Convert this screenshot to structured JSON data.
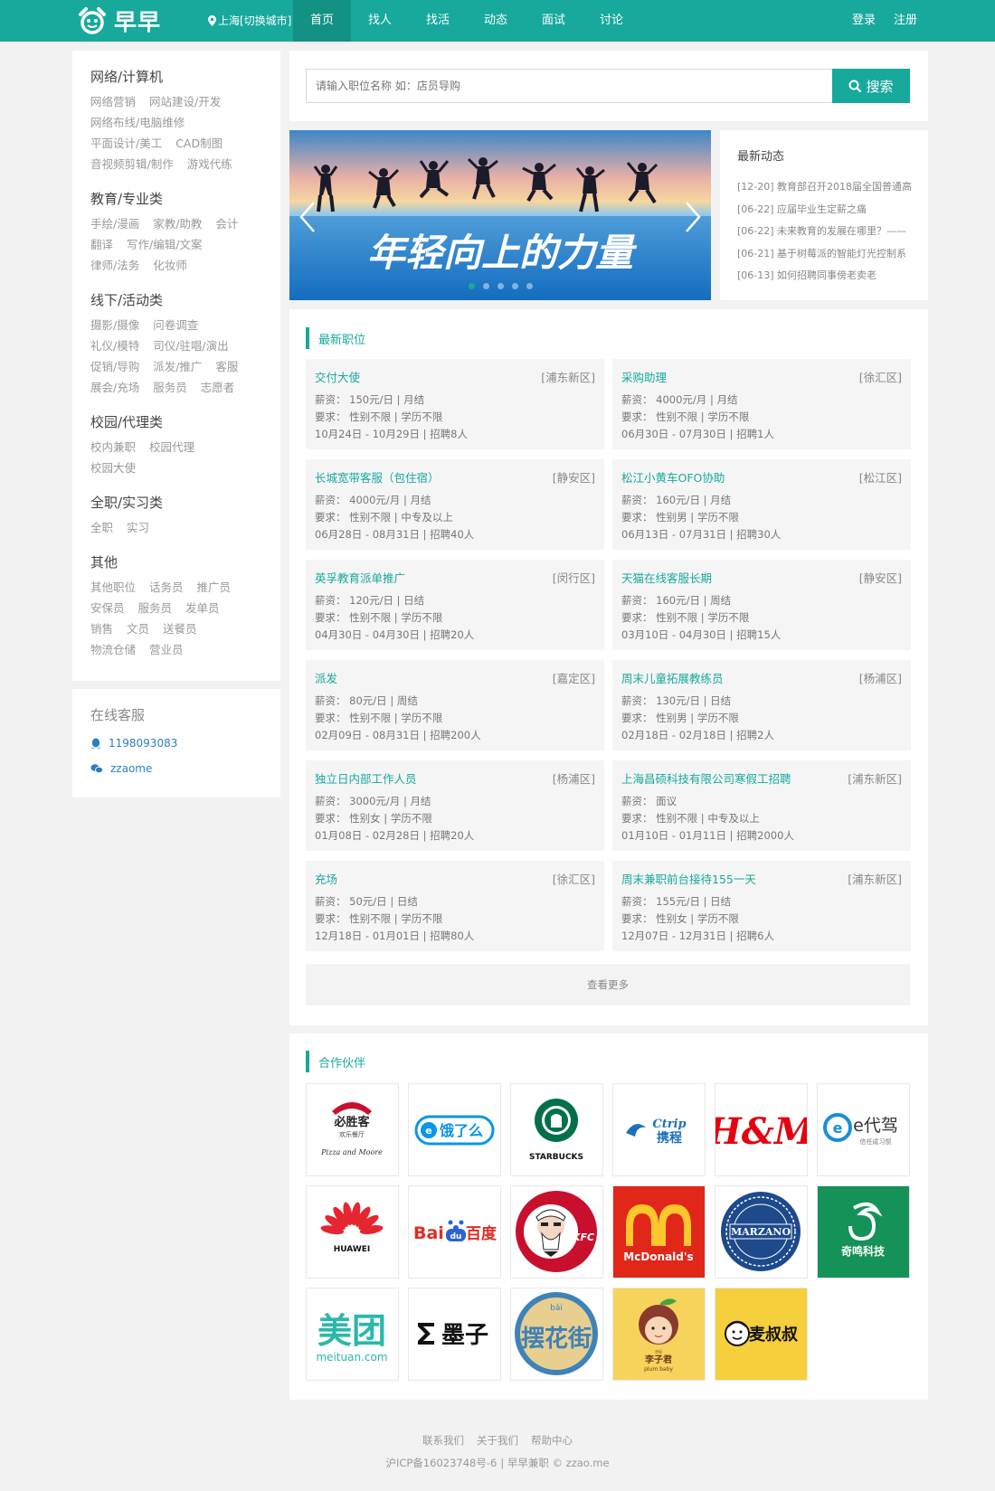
{
  "header": {
    "logo_text": "早早",
    "city": "上海[切换城市]",
    "nav": [
      {
        "label": "首页",
        "active": true
      },
      {
        "label": "找人"
      },
      {
        "label": "找活"
      },
      {
        "label": "动态"
      },
      {
        "label": "面试"
      },
      {
        "label": "讨论"
      }
    ],
    "login": "登录",
    "register": "注册",
    "brand_color": "#17a99c"
  },
  "sidebar": {
    "categories": [
      {
        "title": "网络/计算机",
        "links": [
          "网络营销",
          "网站建设/开发",
          "网络布线/电脑维修",
          "平面设计/美工",
          "CAD制图",
          "音视频剪辑/制作",
          "游戏代练"
        ]
      },
      {
        "title": "教育/专业类",
        "links": [
          "手绘/漫画",
          "家教/助教",
          "会计",
          "翻译",
          "写作/编辑/文案",
          "律师/法务",
          "化妆师"
        ]
      },
      {
        "title": "线下/活动类",
        "links": [
          "摄影/摄像",
          "问卷调查",
          "礼仪/模特",
          "司仪/驻唱/演出",
          "促销/导购",
          "派发/推广",
          "客服",
          "展会/充场",
          "服务员",
          "志愿者"
        ]
      },
      {
        "title": "校园/代理类",
        "links": [
          "校内兼职",
          "校园代理",
          "校园大使"
        ]
      },
      {
        "title": "全职/实习类",
        "links": [
          "全职",
          "实习"
        ]
      },
      {
        "title": "其他",
        "links": [
          "其他职位",
          "话务员",
          "推广员",
          "安保员",
          "服务员",
          "发单员",
          "销售",
          "文员",
          "送餐员",
          "物流仓储",
          "营业员"
        ]
      }
    ]
  },
  "customer_service": {
    "title": "在线客服",
    "qq": "1198093083",
    "wechat": "zzaome"
  },
  "search": {
    "placeholder": "请输入职位名称 如：店员导购",
    "button": "搜索"
  },
  "banner": {
    "slogan": "年轻向上的力量",
    "slide_count": 5,
    "active_slide": 0
  },
  "news": {
    "title": "最新动态",
    "items": [
      "[12-20] 教育部召开2018届全国普通高",
      "[06-22] 应届毕业生定薪之痛",
      "[06-22] 未来教育的发展在哪里？——",
      "[06-21] 基于树莓派的智能灯光控制系",
      "[06-13] 如何招聘同事傍老卖老"
    ]
  },
  "jobs": {
    "title": "最新职位",
    "more": "查看更多",
    "list": [
      {
        "name": "交付大使",
        "area": "[浦东新区]",
        "salary": "薪资： 150元/日 | 月结",
        "req": "要求： 性别不限 | 学历不限",
        "period": "10月24日 - 10月29日 | 招聘8人"
      },
      {
        "name": "采购助理",
        "area": "[徐汇区]",
        "salary": "薪资： 4000元/月 | 月结",
        "req": "要求： 性别不限 | 学历不限",
        "period": "06月30日 - 07月30日 | 招聘1人"
      },
      {
        "name": "长城宽带客服（包住宿）",
        "area": "[静安区]",
        "salary": "薪资： 4000元/月 | 月结",
        "req": "要求： 性别不限 | 中专及以上",
        "period": "06月28日 - 08月31日 | 招聘40人"
      },
      {
        "name": "松江小黄车OFO协助",
        "area": "[松江区]",
        "salary": "薪资： 160元/日 | 月结",
        "req": "要求： 性别男 | 学历不限",
        "period": "06月13日 - 07月31日 | 招聘30人"
      },
      {
        "name": "英孚教育派单推广",
        "area": "[闵行区]",
        "salary": "薪资： 120元/日 | 日结",
        "req": "要求： 性别不限 | 学历不限",
        "period": "04月30日 - 04月30日 | 招聘20人"
      },
      {
        "name": "天猫在线客服长期",
        "area": "[静安区]",
        "salary": "薪资： 160元/日 | 周结",
        "req": "要求： 性别不限 | 学历不限",
        "period": "03月10日 - 04月30日 | 招聘15人"
      },
      {
        "name": "派发",
        "area": "[嘉定区]",
        "salary": "薪资： 80元/日 | 周结",
        "req": "要求： 性别不限 | 学历不限",
        "period": "02月09日 - 08月31日 | 招聘200人"
      },
      {
        "name": "周末儿童拓展教练员",
        "area": "[杨浦区]",
        "salary": "薪资： 130元/日 | 日结",
        "req": "要求： 性别男 | 学历不限",
        "period": "02月18日 - 02月18日 | 招聘2人"
      },
      {
        "name": "独立日内部工作人员",
        "area": "[杨浦区]",
        "salary": "薪资： 3000元/月 | 月结",
        "req": "要求： 性别女 | 学历不限",
        "period": "01月08日 - 02月28日 | 招聘20人"
      },
      {
        "name": "上海昌硕科技有限公司寒假工招聘",
        "area": "[浦东新区]",
        "salary": "薪资： 面议",
        "req": "要求： 性别不限 | 中专及以上",
        "period": "01月10日 - 01月11日 | 招聘2000人"
      },
      {
        "name": "充场",
        "area": "[徐汇区]",
        "salary": "薪资： 50元/日 | 日结",
        "req": "要求： 性别不限 | 学历不限",
        "period": "12月18日 - 01月01日 | 招聘80人"
      },
      {
        "name": "周末兼职前台接待155一天",
        "area": "[浦东新区]",
        "salary": "薪资： 155元/日 | 日结",
        "req": "要求： 性别女 | 学历不限",
        "period": "12月07日 - 12月31日 | 招聘6人"
      }
    ]
  },
  "partners": {
    "title": "合作伙伴",
    "logos": [
      {
        "id": "pizzahut",
        "text": "必胜客",
        "sub": "欢乐餐厅",
        "script": "Pizza and Moore"
      },
      {
        "id": "eleme",
        "text": "饿了么"
      },
      {
        "id": "starbucks",
        "text": "STARBUCKS"
      },
      {
        "id": "ctrip",
        "text": "携程",
        "en": "Ctrip"
      },
      {
        "id": "hm",
        "text": "H&M"
      },
      {
        "id": "edaijia",
        "text": "e代驾",
        "sub": "信任成习惯"
      },
      {
        "id": "huawei",
        "text": "HUAWEI"
      },
      {
        "id": "baidu",
        "text": "Bai",
        "cn": "百度",
        "paw": "du"
      },
      {
        "id": "kfc",
        "text": "KFC"
      },
      {
        "id": "mcdonalds",
        "text": "McDonald's"
      },
      {
        "id": "marzano",
        "text": "MARZANO"
      },
      {
        "id": "qiming",
        "text": "奇鸣科技"
      },
      {
        "id": "meituan",
        "text": "美团",
        "en": "meituan.com"
      },
      {
        "id": "mozi",
        "text": "墨子"
      },
      {
        "id": "baihuajie",
        "text": "摆花街",
        "pinyin": "bǎi"
      },
      {
        "id": "lizijun",
        "text": "李子君",
        "en": "plum baby",
        "mi": "mi"
      },
      {
        "id": "maishushu",
        "text": "麦叔叔"
      }
    ]
  },
  "footer": {
    "links": [
      "联系我们",
      "关于我们",
      "帮助中心"
    ],
    "icp": "沪ICP备16023748号-6",
    "copyright": "| 早早兼职 © zzao.me"
  }
}
